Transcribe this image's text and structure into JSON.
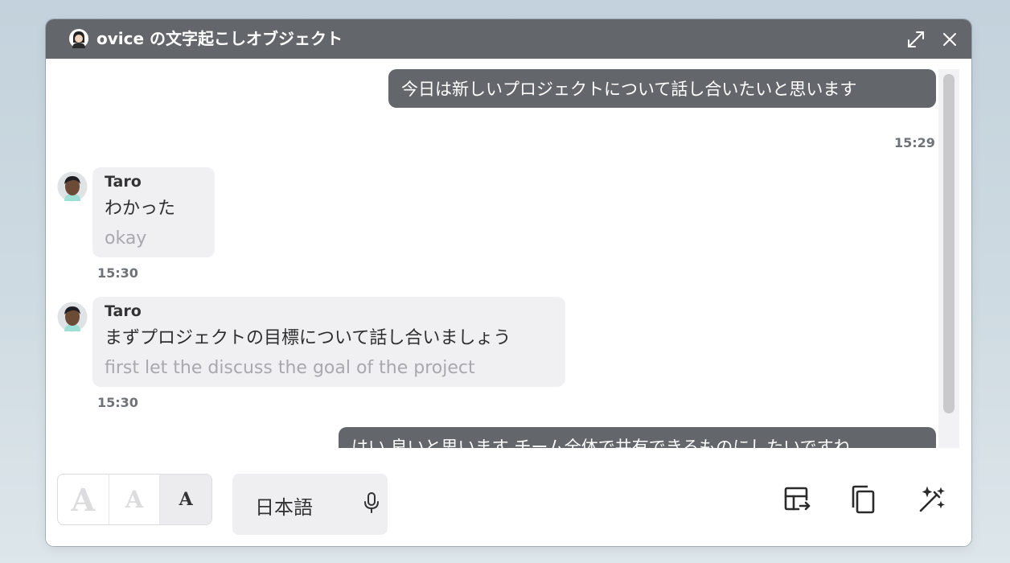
{
  "window": {
    "title": "ovice の文字起こしオブジェクト"
  },
  "messages": [
    {
      "type": "outgoing",
      "text": "今日は新しいプロジェクトについて話し合いたいと思います",
      "time": "15:29"
    },
    {
      "type": "incoming",
      "sender": "Taro",
      "text": "わかった",
      "translation": "okay",
      "time": "15:30"
    },
    {
      "type": "incoming",
      "sender": "Taro",
      "text": "まずプロジェクトの目標について話し合いましょう",
      "translation": "first let the discuss the goal of the project",
      "time": "15:30"
    },
    {
      "type": "outgoing",
      "text": "はい 良いと思います チーム全体で共有できるものにしたいですね"
    }
  ],
  "toolbar": {
    "font_large": "A",
    "font_medium": "A",
    "font_small": "A",
    "language": "日本語"
  },
  "colors": {
    "titlebar": "#63676c",
    "outgoing_bubble": "#63676c",
    "incoming_bubble": "#f0eff2",
    "translation_text": "#a9a9ad"
  },
  "icons": {
    "title": "user-avatar-icon",
    "expand": "expand-icon",
    "close": "close-icon",
    "mic": "microphone-icon",
    "export": "table-export-icon",
    "copy": "copy-icon",
    "magic": "magic-wand-icon"
  }
}
